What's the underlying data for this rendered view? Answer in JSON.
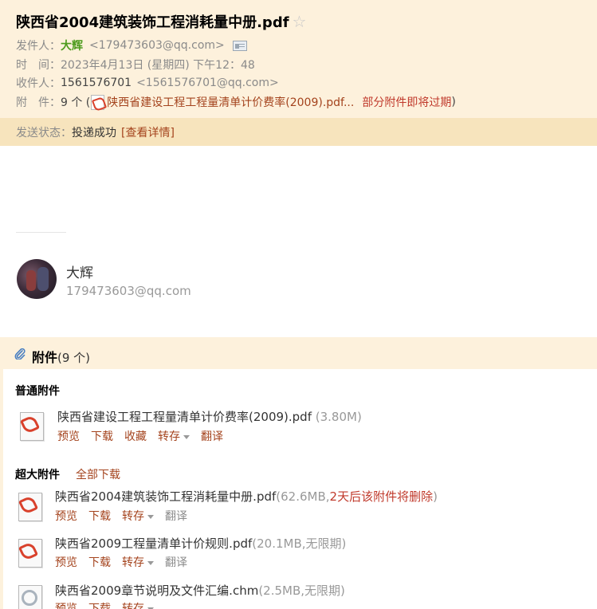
{
  "subject": "陕西省2004建筑装饰工程消耗量中册.pdf",
  "from": {
    "label": "发件人：",
    "name": "大辉",
    "email": "<179473603@qq.com>"
  },
  "time": {
    "label": "时　间：",
    "value": "2023年4月13日 (星期四) 下午12：48"
  },
  "to": {
    "label": "收件人：",
    "name": "1561576701",
    "email": "<1561576701@qq.com>"
  },
  "attachments_summary": {
    "label": "附　件：",
    "count": "9 个 (",
    "first_name": "陕西省建设工程工程量清单计价费率(2009).pdf...",
    "warning": "部分附件即将过期",
    "close": ")"
  },
  "send_status": {
    "label": "发送状态：",
    "value": "投递成功",
    "details_link": "[查看详情]"
  },
  "signature": {
    "name": "大辉",
    "email": "179473603@qq.com"
  },
  "attachment_panel": {
    "title": "附件",
    "count": "(9 个)",
    "normal_section": "普通附件",
    "large_section": "超大附件",
    "download_all": "全部下载",
    "actions": {
      "preview": "预览",
      "download": "下载",
      "favorite": "收藏",
      "save_to": "转存",
      "translate": "翻译"
    },
    "normal_files": [
      {
        "name": "陕西省建设工程工程量清单计价费率(2009).pdf",
        "size": " (3.80M)",
        "icon": "pdf-icon"
      }
    ],
    "large_files": [
      {
        "name": "陕西省2004建筑装饰工程消耗量中册.pdf",
        "size": "(62.6MB,",
        "expire": "2天后该附件将删除",
        "close": ")",
        "icon": "pdf-icon"
      },
      {
        "name": "陕西省2009工程量清单计价规则.pdf",
        "size": "(20.1MB,无限期)",
        "icon": "pdf-icon"
      },
      {
        "name": "陕西省2009章节说明及文件汇编.chm",
        "size": "(2.5MB,无限期)",
        "icon": "chm-icon"
      }
    ]
  }
}
